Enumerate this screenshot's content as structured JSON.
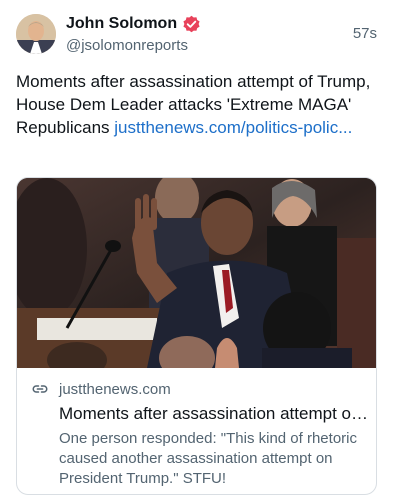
{
  "author": {
    "display_name": "John Solomon",
    "handle": "@jsolomonreports",
    "verified": true,
    "avatar_icon": "avatar-photo"
  },
  "timestamp": "57s",
  "post": {
    "text": "Moments after assassination attempt of Trump, House Dem Leader attacks 'Extreme MAGA' Republicans ",
    "link_text": "justthenews.com/politics-polic..."
  },
  "card": {
    "image": "photo-of-speaker-waving",
    "link_icon": "link-icon",
    "domain": "justthenews.com",
    "title": "Moments after assassination attempt of Trump, House Dem Leader attacks 'Extreme MAGA' Republicans",
    "description": "One person responded: \"This kind of rhetoric caused another assassination attempt on President Trump.\" STFU!"
  },
  "colors": {
    "link": "#1d6fc9",
    "verified_badge": "#e8425b",
    "secondary_text": "#536471",
    "border": "#d9dee3"
  }
}
